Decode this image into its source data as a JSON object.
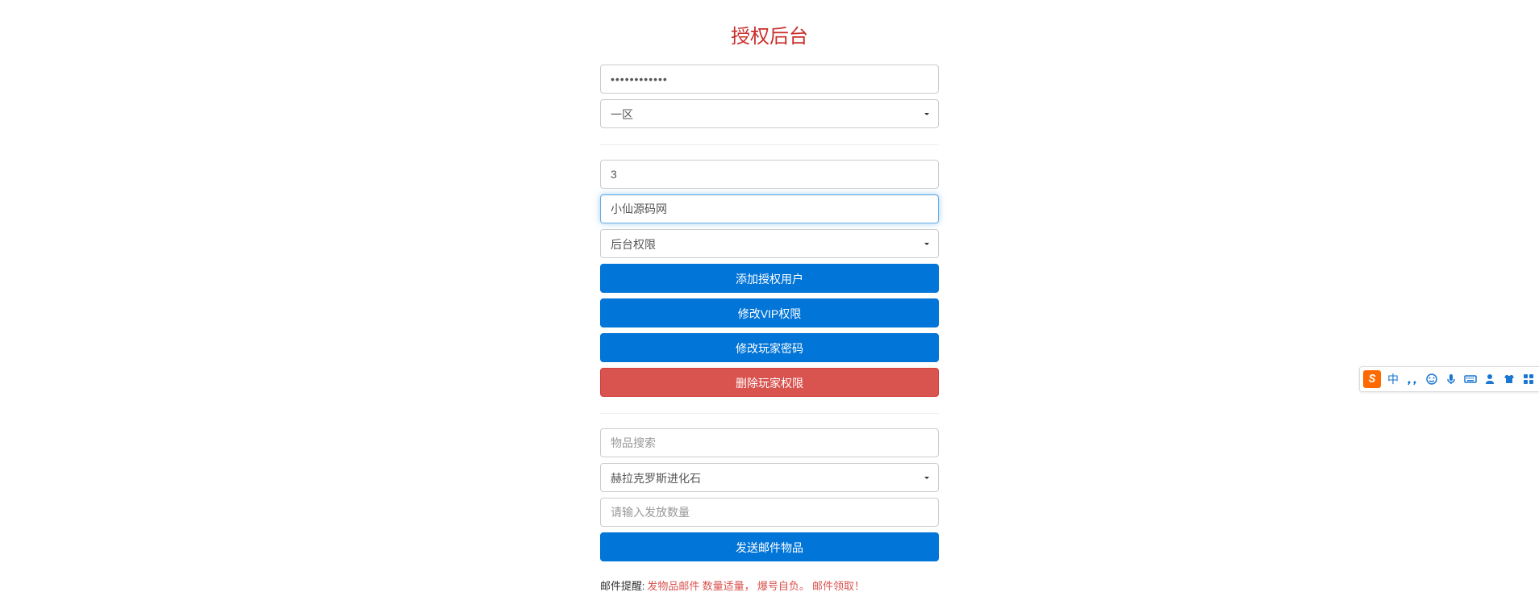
{
  "title": "授权后台",
  "section1": {
    "password_value": "************",
    "region_select": "一区"
  },
  "section2": {
    "user_id_value": "3",
    "username_value": "小仙源码网",
    "permission_select": "后台权限",
    "btn_add_user": "添加授权用户",
    "btn_modify_vip": "修改VIP权限",
    "btn_modify_password": "修改玩家密码",
    "btn_delete_permission": "删除玩家权限"
  },
  "section3": {
    "item_search_placeholder": "物品搜索",
    "item_select": "赫拉克罗斯进化石",
    "quantity_placeholder": "请输入发放数量",
    "btn_send_mail": "发送邮件物品"
  },
  "notice": {
    "label": "邮件提醒: ",
    "text": "发物品邮件 数量适量， 爆号自负。 邮件领取！"
  },
  "ime": {
    "lang": "中"
  }
}
